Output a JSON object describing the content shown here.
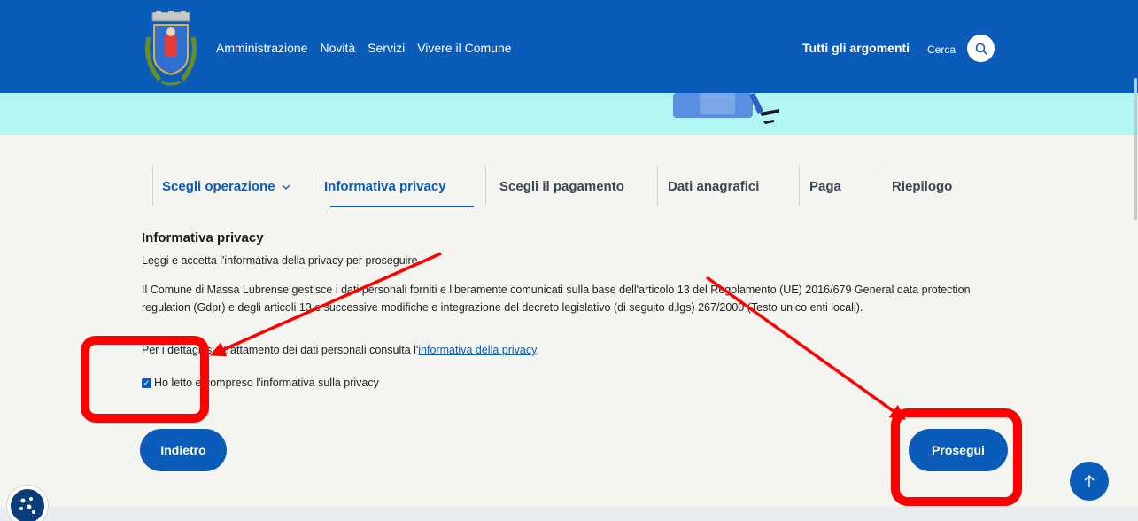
{
  "header": {
    "nav": [
      "Amministrazione",
      "Novità",
      "Servizi",
      "Vivere il Comune"
    ],
    "topics_label": "Tutti gli argomenti",
    "search_label": "Cerca",
    "colors": {
      "brand": "#0a5cb8",
      "hero": "#b2f7f4"
    }
  },
  "steps": [
    {
      "label": "Scegli operazione",
      "state": "done"
    },
    {
      "label": "Informativa privacy",
      "state": "active"
    },
    {
      "label": "Scegli il pagamento",
      "state": "pending"
    },
    {
      "label": "Dati anagrafici",
      "state": "pending"
    },
    {
      "label": "Paga",
      "state": "pending"
    },
    {
      "label": "Riepilogo",
      "state": "pending"
    }
  ],
  "content": {
    "title": "Informativa privacy",
    "intro": "Leggi e accetta l'informativa della privacy per proseguire",
    "body": "Il Comune di Massa Lubrense gestisce i dati personali forniti e liberamente comunicati sulla base dell'articolo 13 del Regolamento (UE) 2016/679 General data protection regulation (Gdpr) e degli articoli 13 e successive modifiche e integrazione del decreto legislativo (di seguito d.lgs) 267/2000 (Testo unico enti locali).",
    "details_prefix": "Per i dettagli sul trattamento dei dati personali consulta l'",
    "details_link": "informativa della privacy",
    "details_suffix": ".",
    "checkbox_label": "Ho letto e compreso l'informativa sulla privacy",
    "checkbox_checked": true
  },
  "buttons": {
    "back": "Indietro",
    "next": "Prosegui"
  },
  "annotations": {
    "color": "#ff0000"
  }
}
